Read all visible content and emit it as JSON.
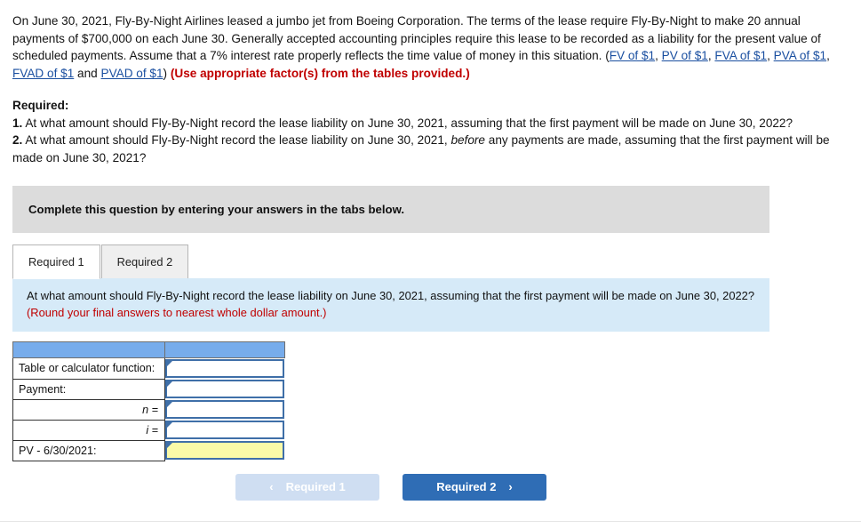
{
  "problem": {
    "part1": "On June 30, 2021, Fly-By-Night Airlines leased a jumbo jet from Boeing Corporation. The terms of the lease require Fly-By-Night to make 20 annual payments of $700,000 on each June 30. Generally accepted accounting principles require this lease to be recorded as a liability for the present value of scheduled payments. Assume that a 7% interest rate properly reflects the time value of money in this situation. (",
    "links": [
      "FV of $1",
      "PV of $1",
      "FVA of $1",
      "PVA of $1",
      "FVAD of $1",
      "PVAD of $1"
    ],
    "separator": ", ",
    "and_word": " and ",
    "close_paren": ") ",
    "red_note": "(Use appropriate factor(s) from the tables provided.)"
  },
  "required": {
    "title": "Required:",
    "item1_num": "1.",
    "item1_text": " At what amount should Fly-By-Night record the lease liability on June 30, 2021, assuming that the first payment will be made on June 30, 2022?",
    "item2_num": "2.",
    "item2_text_a": " At what amount should Fly-By-Night record the lease liability on June 30, 2021, ",
    "item2_italic": "before",
    "item2_text_b": " any payments are made, assuming that the first payment will be made on June 30, 2021?"
  },
  "instruction_banner": {
    "text": "Complete this question by entering your answers in the tabs below."
  },
  "tabs": [
    {
      "label": "Required 1",
      "active": true
    },
    {
      "label": "Required 2",
      "active": false
    }
  ],
  "info_banner": {
    "question": "At what amount should Fly-By-Night record the lease liability on June 30, 2021, assuming that the first payment will be made on June 30, 2022? ",
    "round_note": "(Round your final answers to nearest whole dollar amount.)"
  },
  "answer_table": {
    "header": {
      "col1": "",
      "col2": ""
    },
    "rows": [
      {
        "label": "Table or calculator function:",
        "align": "left",
        "value": "",
        "highlight": false
      },
      {
        "label": "Payment:",
        "align": "left",
        "value": "",
        "highlight": false
      },
      {
        "label": "n =",
        "align": "right",
        "value": "",
        "highlight": false
      },
      {
        "label": "i =",
        "align": "right",
        "value": "",
        "highlight": false
      },
      {
        "label": "PV - 6/30/2021:",
        "align": "left",
        "value": "",
        "highlight": true
      }
    ]
  },
  "nav": {
    "prev_label": "Required 1",
    "prev_chevron": "‹",
    "next_label": "Required 2",
    "next_chevron": "›"
  },
  "colors": {
    "accent_blue": "#2f6db5",
    "header_blue": "#77aceb",
    "info_blue": "#d6eaf8",
    "grey_banner": "#dcdcdc",
    "highlight_yellow": "#fafaa8",
    "red": "#c00000",
    "link_blue": "#1a4fa0"
  }
}
